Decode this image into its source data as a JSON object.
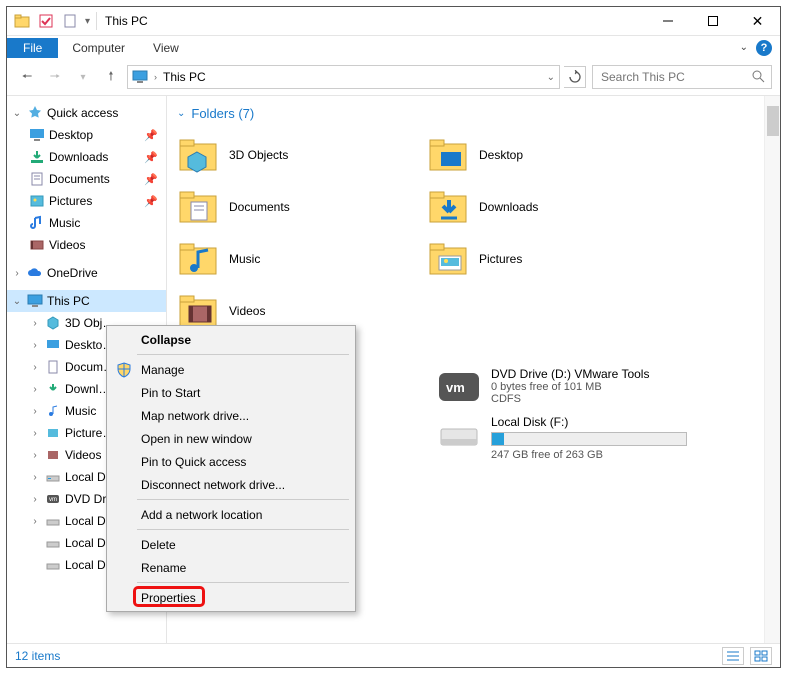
{
  "window": {
    "title": "This PC"
  },
  "ribbon": {
    "file": "File",
    "computer": "Computer",
    "view": "View"
  },
  "address": {
    "crumb": "This PC"
  },
  "search": {
    "placeholder": "Search This PC"
  },
  "nav": {
    "quick": {
      "label": "Quick access",
      "items": [
        {
          "label": "Desktop",
          "pin": true
        },
        {
          "label": "Downloads",
          "pin": true
        },
        {
          "label": "Documents",
          "pin": true
        },
        {
          "label": "Pictures",
          "pin": true
        },
        {
          "label": "Music",
          "pin": false
        },
        {
          "label": "Videos",
          "pin": false
        }
      ]
    },
    "onedrive": {
      "label": "OneDrive"
    },
    "thispc": {
      "label": "This PC",
      "items": [
        {
          "label": "3D Objects",
          "trunc": "3D Obj…"
        },
        {
          "label": "Desktop",
          "trunc": "Deskto…"
        },
        {
          "label": "Documents",
          "trunc": "Docum…"
        },
        {
          "label": "Downloads",
          "trunc": "Downl…"
        },
        {
          "label": "Music",
          "trunc": "Music"
        },
        {
          "label": "Pictures",
          "trunc": "Picture…"
        },
        {
          "label": "Videos",
          "trunc": "Videos"
        },
        {
          "label": "Local Disk (C:)",
          "trunc": "Local D…"
        },
        {
          "label": "DVD Drive (D:)",
          "trunc": "DVD Dr…"
        },
        {
          "label": "Local Disk (E:)",
          "trunc": "Local D…"
        },
        {
          "label": "Local Disk (G:)",
          "trunc": "Local D…"
        },
        {
          "label": "Local Disk (F:)",
          "trunc": "Local Di…"
        }
      ]
    }
  },
  "folders": {
    "header": "Folders (7)",
    "items": [
      "3D Objects",
      "Desktop",
      "Documents",
      "Downloads",
      "Music",
      "Pictures",
      "Videos"
    ]
  },
  "drives": [
    {
      "name": "DVD Drive (D:) VMware Tools",
      "free": "0 bytes free of 101 MB",
      "fs": "CDFS",
      "pct": 0
    },
    {
      "name": "Local Disk (F:)",
      "free": "247 GB free of 263 GB",
      "pct": 6
    }
  ],
  "context_menu": {
    "items": [
      {
        "label": "Collapse",
        "bold": true
      },
      {
        "sep": true
      },
      {
        "label": "Manage",
        "icon": "shield"
      },
      {
        "label": "Pin to Start"
      },
      {
        "label": "Map network drive..."
      },
      {
        "label": "Open in new window"
      },
      {
        "label": "Pin to Quick access"
      },
      {
        "label": "Disconnect network drive..."
      },
      {
        "sep": true
      },
      {
        "label": "Add a network location"
      },
      {
        "sep": true
      },
      {
        "label": "Delete"
      },
      {
        "label": "Rename"
      },
      {
        "sep": true
      },
      {
        "label": "Properties",
        "highlight": true
      }
    ]
  },
  "status": {
    "items": "12 items"
  }
}
